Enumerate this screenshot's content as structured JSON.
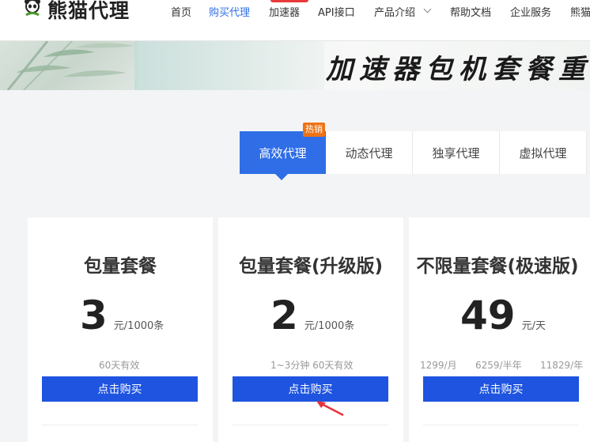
{
  "header": {
    "brand": "熊猫代理",
    "nav": [
      {
        "label": "首页",
        "active": false
      },
      {
        "label": "购买代理",
        "active": true
      },
      {
        "label": "加速器",
        "active": false
      },
      {
        "label": "API接口",
        "active": false
      },
      {
        "label": "产品介绍",
        "active": false
      },
      {
        "label": "帮助文档",
        "active": false
      },
      {
        "label": "企业服务",
        "active": false
      },
      {
        "label": "熊猫",
        "active": false
      }
    ]
  },
  "banner": {
    "title": "加速器包机套餐重磅"
  },
  "tabs": {
    "hot_badge": "热销",
    "items": [
      "高效代理",
      "动态代理",
      "独享代理",
      "虚拟代理"
    ]
  },
  "cards": [
    {
      "title": "包量套餐",
      "price": "3",
      "unit": "元/1000条",
      "notes": [
        "60天有效"
      ],
      "button": "点击购买"
    },
    {
      "title": "包量套餐(升级版)",
      "price": "2",
      "unit": "元/1000条",
      "notes": [
        "1~3分钟 60天有效"
      ],
      "button": "点击购买"
    },
    {
      "title": "不限量套餐(极速版)",
      "price": "49",
      "unit": "元/天",
      "notes": [
        "1299/月",
        "6259/半年",
        "11829/年"
      ],
      "button": "点击购买"
    }
  ],
  "colors": {
    "accent": "#2f6ee6",
    "button": "#1f54e0",
    "hot": "#ee7216",
    "arrow": "#e8323a"
  }
}
